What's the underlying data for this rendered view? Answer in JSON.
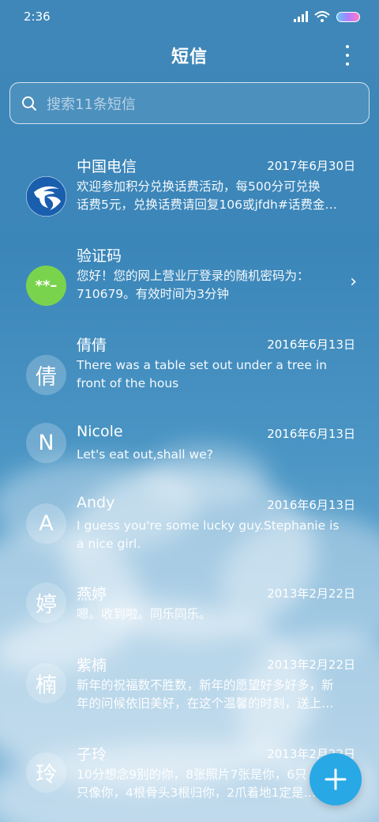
{
  "status": {
    "time": "2:36",
    "icons": [
      "signal-icon",
      "wifi-icon",
      "battery-icon"
    ]
  },
  "header": {
    "title": "短信",
    "menu_icon": "more-vertical-icon"
  },
  "search": {
    "placeholder": "搜索11条短信",
    "icon": "search-icon"
  },
  "conversations": [
    {
      "name": "中国电信",
      "date": "2017年6月30日",
      "avatar": "",
      "avatar_type": "telecom-logo",
      "line1": "欢迎参加积分兑换话费活动，每500分可兑换",
      "line2": "话费5元，兑换话费请回复106或jfdh#话费金…"
    },
    {
      "name": "验证码",
      "date": "",
      "avatar": "**–",
      "avatar_type": "code",
      "line1": "您好！您的网上营业厅登录的随机密码为：",
      "line2": "710679。有效时间为3分钟"
    },
    {
      "name": "倩倩",
      "date": "2016年6月13日",
      "avatar": "倩",
      "line1": "There was a table set out under a tree in",
      "line2": "front of the hous"
    },
    {
      "name": "Nicole",
      "date": "2016年6月13日",
      "avatar": "N",
      "line1": "Let's eat out,shall we?",
      "line2": ""
    },
    {
      "name": "Andy",
      "date": "2016年6月13日",
      "avatar": "A",
      "line1": "I guess you're some lucky guy.Stephanie is",
      "line2": "a nice girl."
    },
    {
      "name": "燕婷",
      "date": "2013年2月22日",
      "avatar": "婷",
      "line1": "嗯。收到啦。同乐同乐。",
      "line2": ""
    },
    {
      "name": "紫楠",
      "date": "2013年2月22日",
      "avatar": "楠",
      "line1": "新年的祝福数不胜数，新年的愿望好多好多，新",
      "line2": "年的问候依旧美好，在这个温馨的时刻，送上…"
    },
    {
      "name": "子玲",
      "date": "2013年2月22日",
      "avatar": "玲",
      "line1": "10分想念9别的你，8张照片7张是你，6只",
      "line2": "只像你，4根骨头3根归你，2爪着地1定是…"
    }
  ],
  "fab": {
    "icon": "plus-icon"
  },
  "colors": {
    "fab": "#29a8e6",
    "code_avatar": "#7ad34c",
    "telecom_blue": "#1a5fae"
  }
}
